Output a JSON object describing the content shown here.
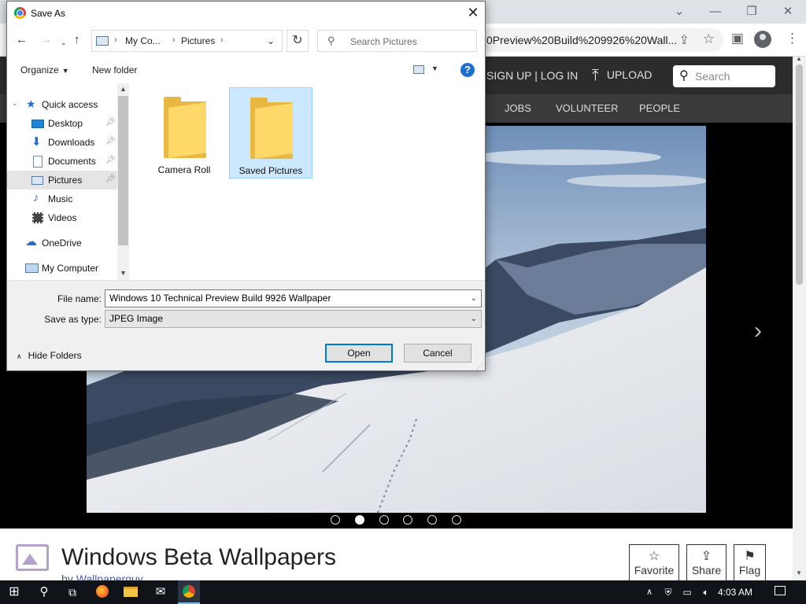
{
  "browser": {
    "url_fragment": "0Preview%20Build%209926%20Wall...",
    "window_controls": {
      "minimize": "—",
      "restore": "❐",
      "close": "✕",
      "tab_menu": "⌄"
    }
  },
  "site": {
    "auth_links": "SIGN UP | LOG IN",
    "upload_label": "UPLOAD",
    "search_placeholder": "Search",
    "nav": [
      "JOBS",
      "VOLUNTEER",
      "PEOPLE"
    ],
    "carousel_dots": 6,
    "carousel_active": 1,
    "page_title": "Windows Beta Wallpapers",
    "byline_prefix": "by",
    "author": "Wallpaperguy",
    "actions": [
      {
        "label": "Favorite",
        "icon": "star-icon"
      },
      {
        "label": "Share",
        "icon": "share-icon"
      },
      {
        "label": "Flag",
        "icon": "flag-icon"
      }
    ]
  },
  "dialog": {
    "title": "Save As",
    "breadcrumbs": [
      "My Co...",
      "Pictures"
    ],
    "search_placeholder": "Search Pictures",
    "organize_label": "Organize",
    "new_folder_label": "New folder",
    "help_label": "?",
    "nav_items": [
      {
        "label": "Quick access",
        "icon": "star-icon",
        "pinned": false,
        "selected": false
      },
      {
        "label": "Desktop",
        "icon": "desktop-icon",
        "pinned": true,
        "selected": false
      },
      {
        "label": "Downloads",
        "icon": "download-icon",
        "pinned": true,
        "selected": false
      },
      {
        "label": "Documents",
        "icon": "document-icon",
        "pinned": true,
        "selected": false
      },
      {
        "label": "Pictures",
        "icon": "pictures-icon",
        "pinned": true,
        "selected": true
      },
      {
        "label": "Music",
        "icon": "music-icon",
        "pinned": false,
        "selected": false
      },
      {
        "label": "Videos",
        "icon": "video-icon",
        "pinned": false,
        "selected": false
      },
      {
        "label": "OneDrive",
        "icon": "cloud-icon",
        "pinned": false,
        "selected": false
      },
      {
        "label": "My Computer",
        "icon": "computer-icon",
        "pinned": false,
        "selected": false
      }
    ],
    "files": [
      {
        "name": "Camera Roll",
        "selected": false
      },
      {
        "name": "Saved Pictures",
        "selected": true
      }
    ],
    "file_name_label": "File name:",
    "file_name_value": "Windows 10 Technical Preview Build 9926 Wallpaper",
    "save_type_label": "Save as type:",
    "save_type_value": "JPEG Image",
    "hide_folders_label": "Hide Folders",
    "primary_button": "Open",
    "cancel_button": "Cancel"
  },
  "taskbar": {
    "time": "4:03 AM",
    "apps": [
      "windows-start-icon",
      "search-icon",
      "task-view-icon",
      "firefox-icon",
      "file-explorer-icon",
      "mail-icon",
      "chrome-icon"
    ]
  },
  "colors": {
    "accent": "#0078d7",
    "folder": "#ffd86a",
    "selection": "#cce8ff",
    "site_header": "#2c2c2c"
  }
}
